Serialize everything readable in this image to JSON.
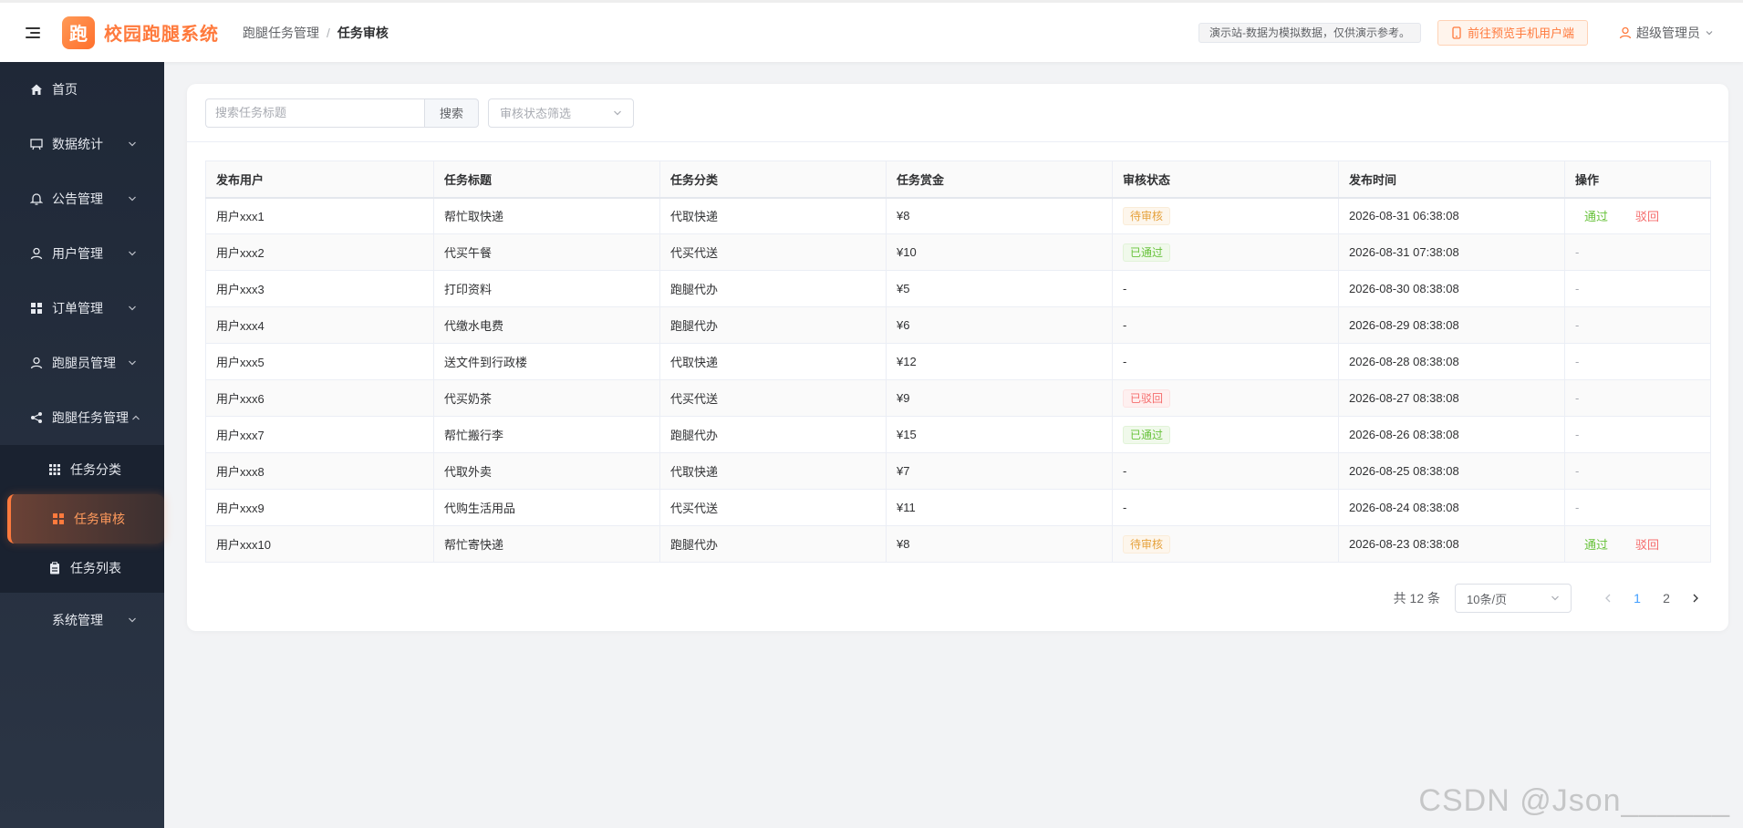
{
  "header": {
    "logo_char": "跑",
    "app_title": "校园跑腿系统",
    "breadcrumb": [
      "跑腿任务管理",
      "任务审核"
    ],
    "demo_notice": "演示站-数据为模拟数据，仅供演示参考。",
    "mobile_link": "前往预览手机用户端",
    "user_name": "超级管理员"
  },
  "sidebar": {
    "items": [
      {
        "label": "首页",
        "icon": "home-icon"
      },
      {
        "label": "数据统计",
        "icon": "chart-icon"
      },
      {
        "label": "公告管理",
        "icon": "bell-icon"
      },
      {
        "label": "用户管理",
        "icon": "user-icon"
      },
      {
        "label": "订单管理",
        "icon": "grid-icon"
      },
      {
        "label": "跑腿员管理",
        "icon": "user-icon"
      },
      {
        "label": "跑腿任务管理",
        "icon": "share-icon"
      }
    ],
    "sub_items": [
      {
        "label": "任务分类",
        "icon": "apps-icon"
      },
      {
        "label": "任务审核",
        "icon": "grid-icon"
      },
      {
        "label": "任务列表",
        "icon": "clipboard-icon"
      }
    ],
    "last_item": {
      "label": "系统管理"
    }
  },
  "toolbar": {
    "search_placeholder": "搜索任务标题",
    "search_button": "搜索",
    "status_placeholder": "审核状态筛选"
  },
  "table": {
    "columns": [
      "发布用户",
      "任务标题",
      "任务分类",
      "任务赏金",
      "审核状态",
      "发布时间",
      "操作"
    ],
    "rows": [
      {
        "user": "用户xxx1",
        "title": "帮忙取快递",
        "category": "代取快递",
        "reward": "¥8",
        "status": "待审核",
        "status_type": "pending",
        "time": "2026-08-31 06:38:08",
        "actions": true
      },
      {
        "user": "用户xxx2",
        "title": "代买午餐",
        "category": "代买代送",
        "reward": "¥10",
        "status": "已通过",
        "status_type": "passed",
        "time": "2026-08-31 07:38:08",
        "actions": false
      },
      {
        "user": "用户xxx3",
        "title": "打印资料",
        "category": "跑腿代办",
        "reward": "¥5",
        "status": "-",
        "status_type": "none",
        "time": "2026-08-30 08:38:08",
        "actions": false
      },
      {
        "user": "用户xxx4",
        "title": "代缴水电费",
        "category": "跑腿代办",
        "reward": "¥6",
        "status": "-",
        "status_type": "none",
        "time": "2026-08-29 08:38:08",
        "actions": false
      },
      {
        "user": "用户xxx5",
        "title": "送文件到行政楼",
        "category": "代取快递",
        "reward": "¥12",
        "status": "-",
        "status_type": "none",
        "time": "2026-08-28 08:38:08",
        "actions": false
      },
      {
        "user": "用户xxx6",
        "title": "代买奶茶",
        "category": "代买代送",
        "reward": "¥9",
        "status": "已驳回",
        "status_type": "rejected",
        "time": "2026-08-27 08:38:08",
        "actions": false
      },
      {
        "user": "用户xxx7",
        "title": "帮忙搬行李",
        "category": "跑腿代办",
        "reward": "¥15",
        "status": "已通过",
        "status_type": "passed",
        "time": "2026-08-26 08:38:08",
        "actions": false
      },
      {
        "user": "用户xxx8",
        "title": "代取外卖",
        "category": "代取快递",
        "reward": "¥7",
        "status": "-",
        "status_type": "none",
        "time": "2026-08-25 08:38:08",
        "actions": false
      },
      {
        "user": "用户xxx9",
        "title": "代购生活用品",
        "category": "代买代送",
        "reward": "¥11",
        "status": "-",
        "status_type": "none",
        "time": "2026-08-24 08:38:08",
        "actions": false
      },
      {
        "user": "用户xxx10",
        "title": "帮忙寄快递",
        "category": "跑腿代办",
        "reward": "¥8",
        "status": "待审核",
        "status_type": "pending",
        "time": "2026-08-23 08:38:08",
        "actions": true
      }
    ],
    "approve_label": "通过",
    "reject_label": "驳回",
    "empty_op": "-"
  },
  "pagination": {
    "total": "共 12 条",
    "page_size": "10条/页",
    "pages": [
      "1",
      "2"
    ],
    "current": "1"
  },
  "watermark": "CSDN @Json______",
  "colors": {
    "brand": "#ff7a3d",
    "sidebar_bg": "#1f2837",
    "pending": "#e6a23c",
    "passed": "#67c23a",
    "rejected": "#f56c6c",
    "page_active": "#409eff"
  }
}
